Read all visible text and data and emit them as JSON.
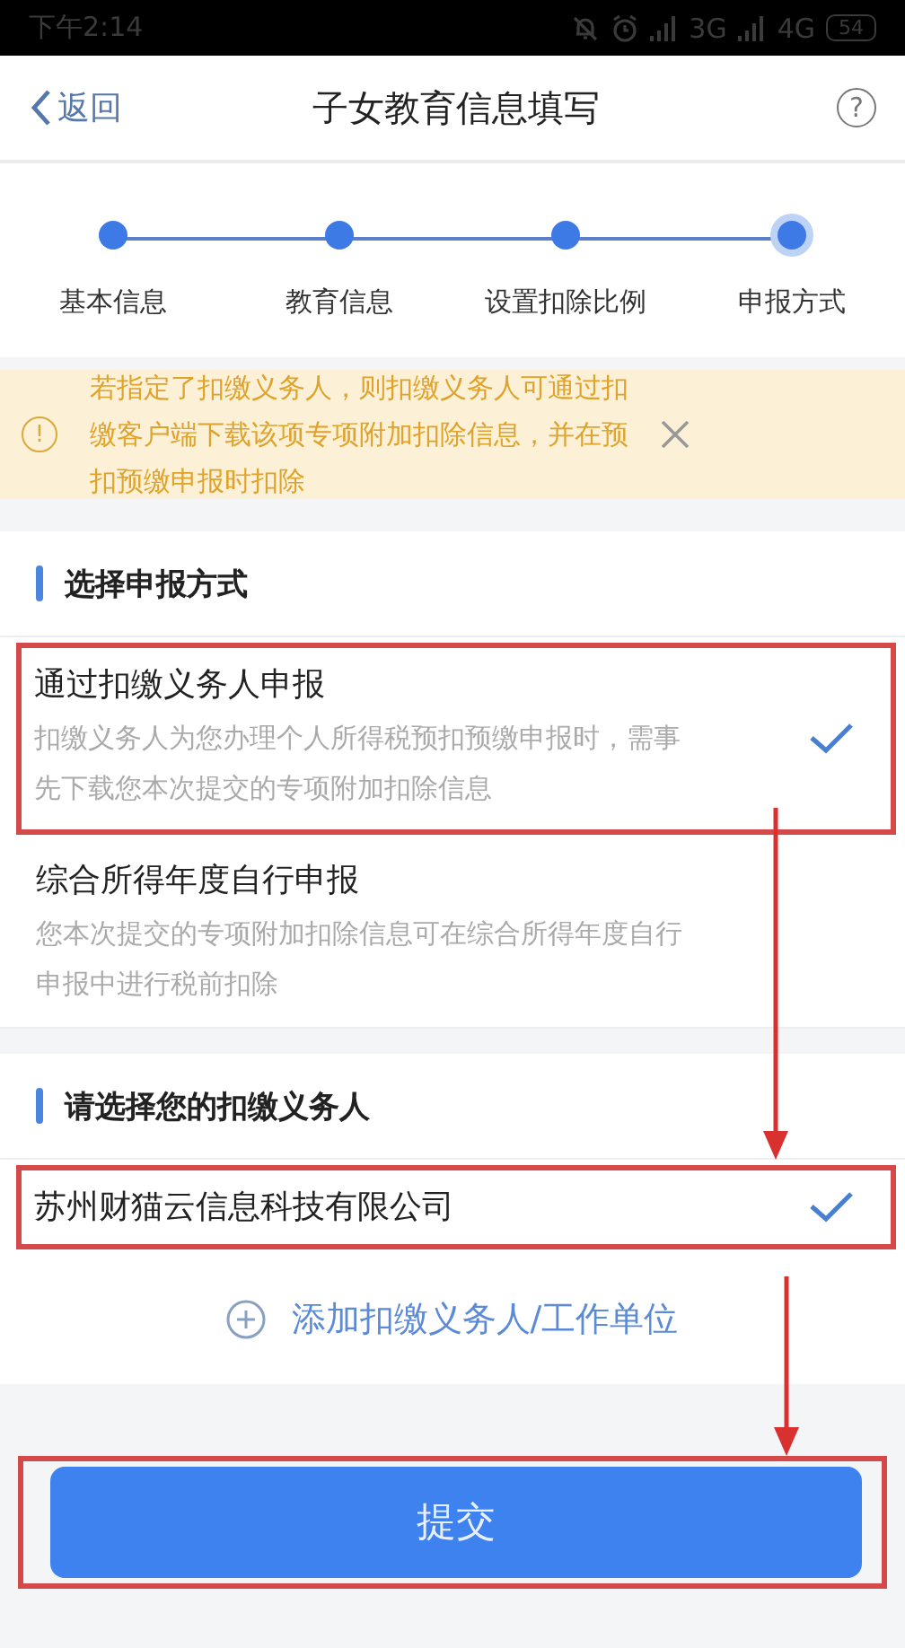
{
  "status_bar": {
    "time": "下午2:14",
    "network_1": "3G",
    "network_2": "4G",
    "battery": "54"
  },
  "nav": {
    "back": "返回",
    "title": "子女教育信息填写",
    "help": "?"
  },
  "steps": [
    {
      "label": "基本信息",
      "current": false
    },
    {
      "label": "教育信息",
      "current": false
    },
    {
      "label": "设置扣除比例",
      "current": false
    },
    {
      "label": "申报方式",
      "current": true
    }
  ],
  "notice": {
    "text": "若指定了扣缴义务人，则扣缴义务人可通过扣缴客户端下载该项专项附加扣除信息，并在预扣预缴申报时扣除",
    "icon": "!"
  },
  "method_section": {
    "title": "选择申报方式",
    "options": [
      {
        "title": "通过扣缴义务人申报",
        "description": "扣缴义务人为您办理个人所得税预扣预缴申报时，需事先下载您本次提交的专项附加扣除信息",
        "selected": true,
        "highlighted": true
      },
      {
        "title": "综合所得年度自行申报",
        "description": "您本次提交的专项附加扣除信息可在综合所得年度自行申报中进行税前扣除",
        "selected": false,
        "highlighted": false
      }
    ]
  },
  "withholder_section": {
    "title": "请选择您的扣缴义务人",
    "options": [
      {
        "title": "苏州财猫云信息科技有限公司",
        "selected": true,
        "highlighted": true,
        "arrow": true
      }
    ],
    "add_link": "添加扣缴义务人/工作单位"
  },
  "submit": {
    "label": "提交",
    "highlighted": true,
    "arrow": true
  }
}
